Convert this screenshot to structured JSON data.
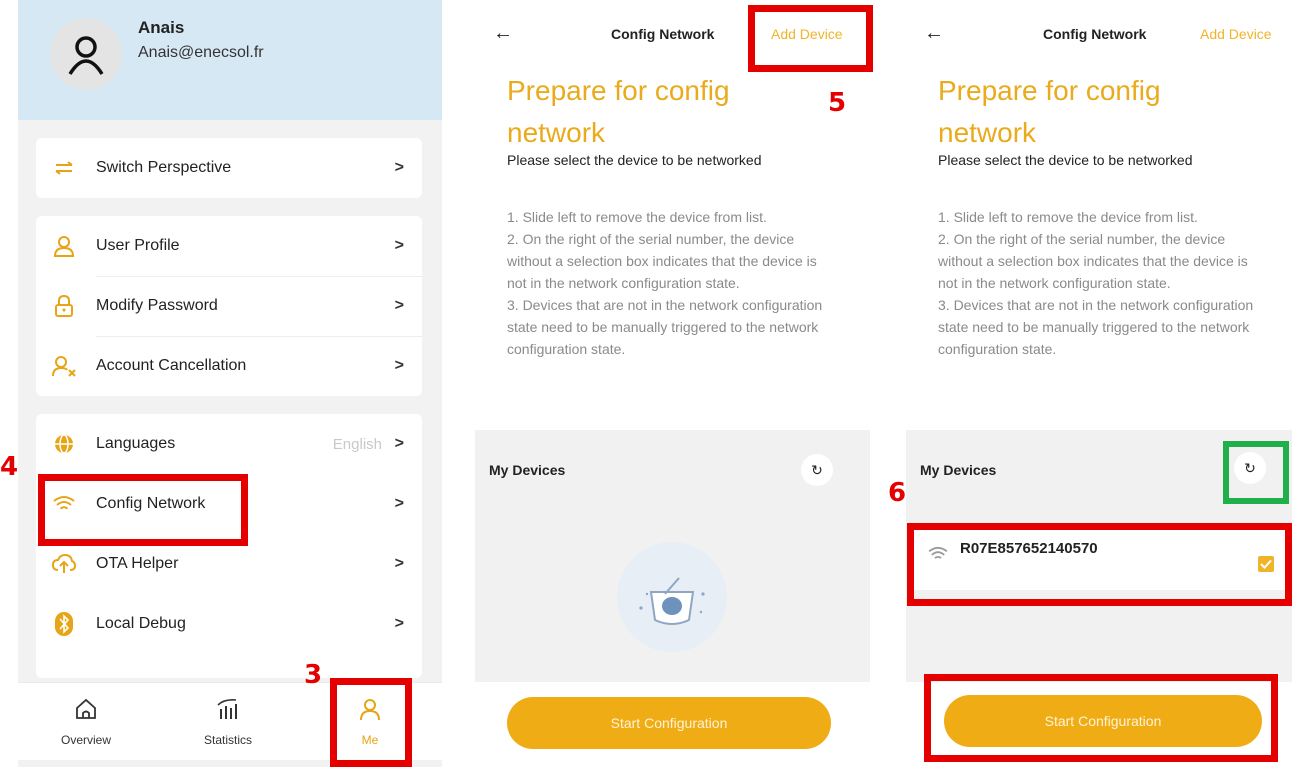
{
  "panel1": {
    "user": {
      "name": "Anais",
      "email": "Anais@enecsol.fr"
    },
    "menu": {
      "switch_perspective": "Switch Perspective",
      "user_profile": "User Profile",
      "modify_password": "Modify Password",
      "account_cancellation": "Account Cancellation",
      "languages": "Languages",
      "languages_value": "English",
      "config_network": "Config Network",
      "ota_helper": "OTA Helper",
      "local_debug": "Local Debug",
      "chevron": ">"
    },
    "tabs": {
      "overview": "Overview",
      "statistics": "Statistics",
      "me": "Me"
    }
  },
  "config_screen": {
    "back": "←",
    "title": "Config Network",
    "add_device": "Add Device",
    "heading": "Prepare for config network",
    "subheading": "Please select the device to be networked",
    "instructions": "1. Slide left to remove the device from list.\n2. On the right of the serial number, the device without a selection box indicates that the device is not in the network configuration state.\n3. Devices that are not in the network configuration state need to be manually triggered to the network configuration state.",
    "my_devices": "My Devices",
    "refresh_glyph": "↻",
    "start_button": "Start Configuration"
  },
  "panel3": {
    "device_serial": "R07E857652140570",
    "device_selected": true
  },
  "annotations": {
    "step3": "3",
    "step4": "4",
    "step5": "5",
    "step6": "6"
  },
  "colors": {
    "accent": "#f0ac14",
    "heading": "#e9ab1c",
    "highlight_red": "#e50000",
    "highlight_green": "#1fb04c",
    "header_bg": "#d7e8f5"
  }
}
